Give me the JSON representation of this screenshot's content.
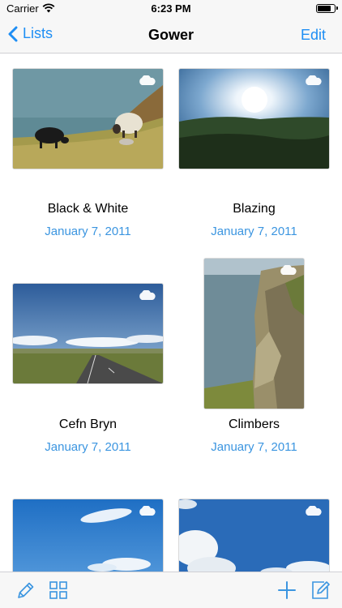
{
  "status": {
    "carrier": "Carrier",
    "time": "6:23 PM",
    "battery_level": 0.85
  },
  "nav": {
    "back_label": "Lists",
    "title": "Gower",
    "edit_label": "Edit"
  },
  "items": [
    {
      "title": "Black & White",
      "date": "January 7, 2011"
    },
    {
      "title": "Blazing",
      "date": "January 7, 2011"
    },
    {
      "title": "Cefn Bryn",
      "date": "January 7, 2011"
    },
    {
      "title": "Climbers",
      "date": "January 7, 2011"
    },
    {
      "title": "",
      "date": ""
    },
    {
      "title": "",
      "date": ""
    }
  ],
  "toolbar": {
    "left_icons": [
      "pencil-icon",
      "grid-icon"
    ],
    "right_icons": [
      "plus-icon",
      "compose-icon"
    ]
  },
  "colors": {
    "accent": "#1e8ef4",
    "date": "#3b95e0",
    "bar": "#f7f7f7"
  }
}
